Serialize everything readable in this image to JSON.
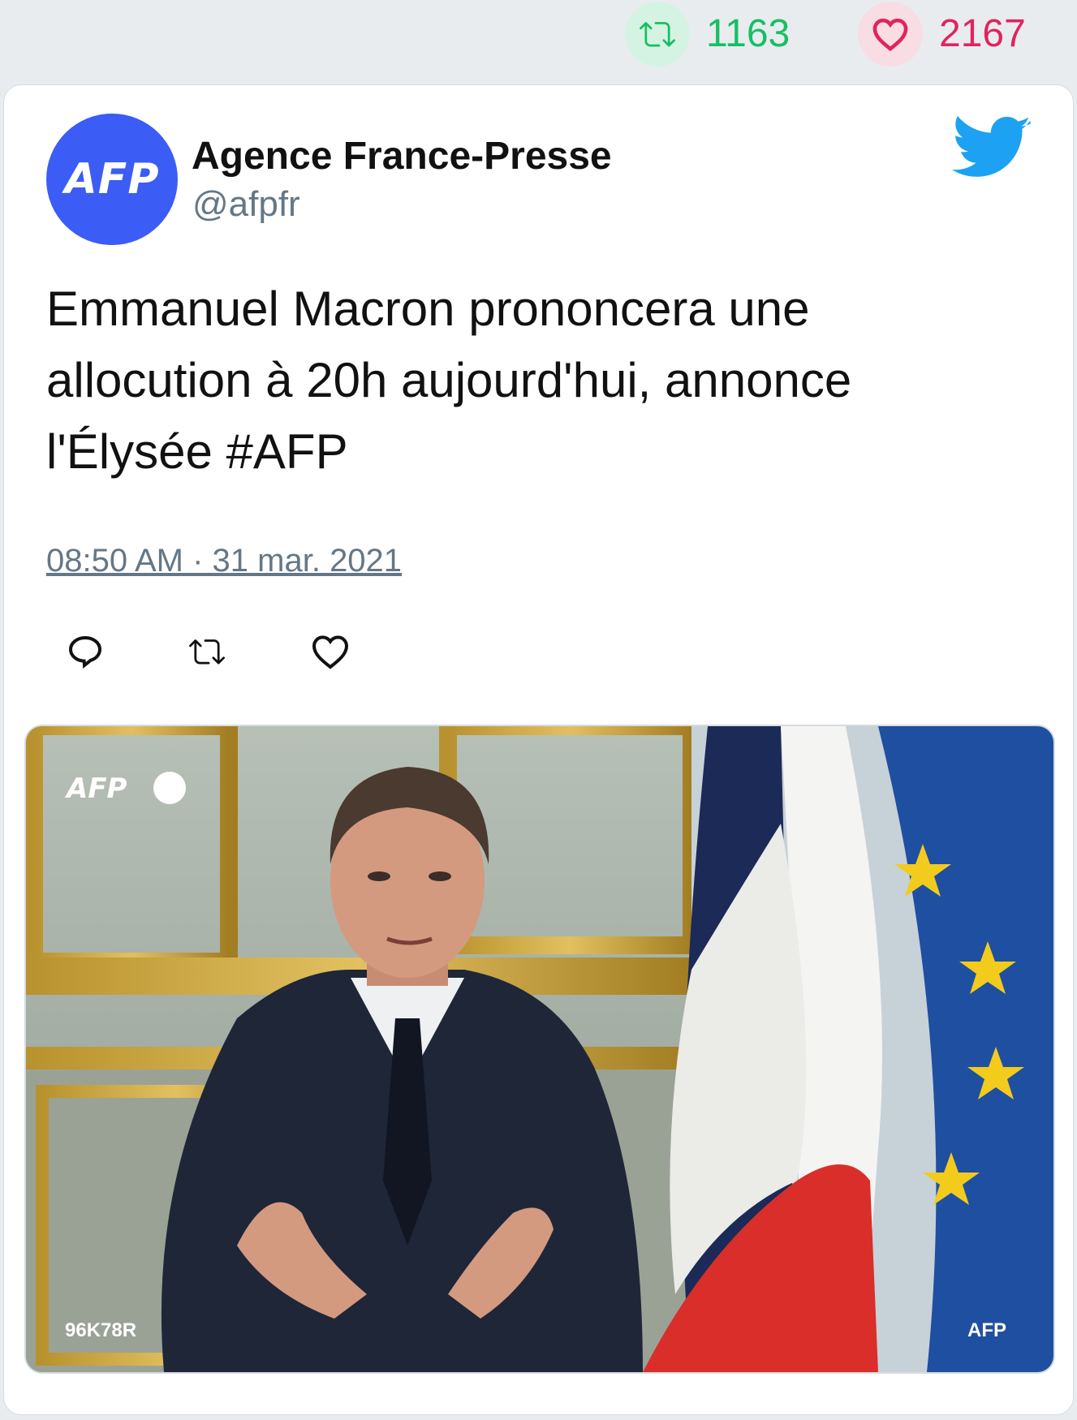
{
  "stats": {
    "retweets": "1163",
    "likes": "2167",
    "retweet_color": "#17bf63",
    "like_color": "#e0245e"
  },
  "tweet": {
    "avatar_text": "AFP",
    "author_name": "Agence France-Presse",
    "author_handle": "@afpfr",
    "text": "Emmanuel Macron prononcera une allocution à 20h aujourd'hui, annonce l'Élysée #AFP",
    "timestamp": "08:50 AM · 31 mar. 2021",
    "platform_icon": "twitter-bird-icon"
  },
  "actions": [
    {
      "name": "reply",
      "icon": "reply-icon"
    },
    {
      "name": "retweet",
      "icon": "retweet-icon"
    },
    {
      "name": "like",
      "icon": "heart-icon"
    }
  ],
  "media": {
    "watermark_top": "AFP",
    "code_bottom_left": "96K78R",
    "credit_bottom_right": "AFP"
  },
  "colors": {
    "brand_blue": "#1da1f2",
    "avatar_blue": "#3b5cf5",
    "muted": "#657786"
  }
}
